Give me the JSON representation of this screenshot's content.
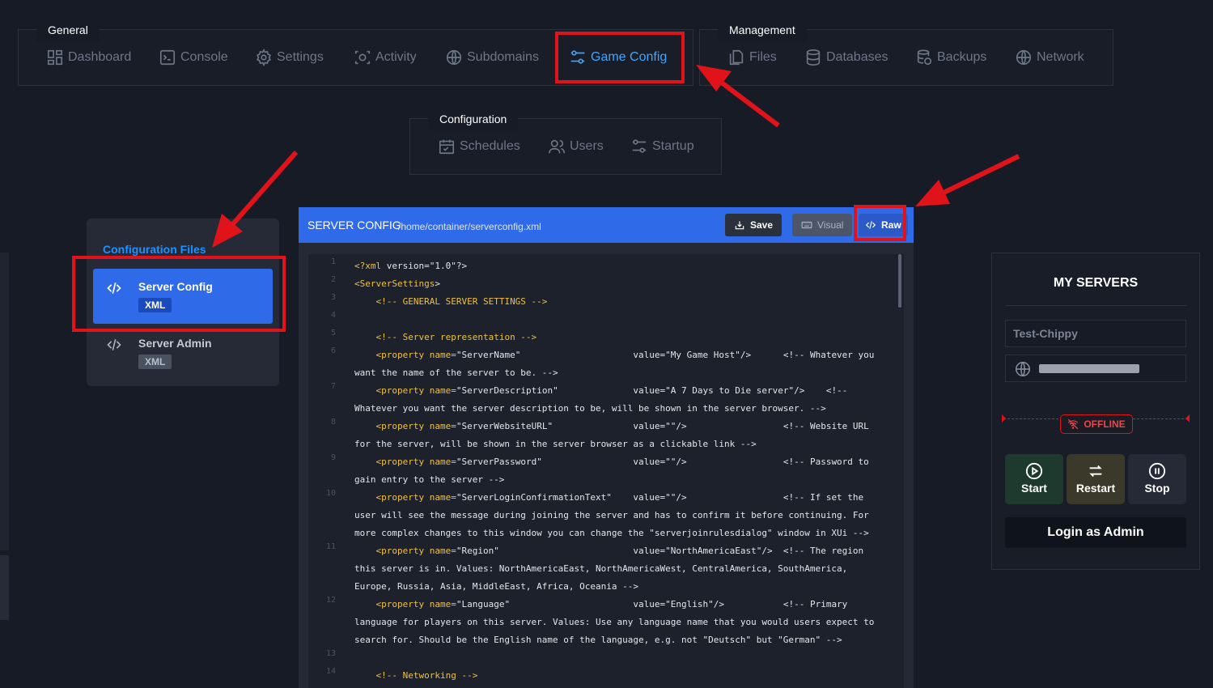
{
  "colors": {
    "background": "#161b25",
    "accent_blue": "#2f6ae8",
    "active_nav": "#3ea6ff",
    "annotation_red": "#e0131b",
    "code_tag": "#f0c040"
  },
  "nav_groups": {
    "general": {
      "title": "General",
      "items": [
        {
          "label": "Dashboard",
          "icon": "dashboard-icon"
        },
        {
          "label": "Console",
          "icon": "console-icon"
        },
        {
          "label": "Settings",
          "icon": "gear-icon"
        },
        {
          "label": "Activity",
          "icon": "activity-icon"
        },
        {
          "label": "Subdomains",
          "icon": "globe-icon"
        },
        {
          "label": "Game Config",
          "icon": "sliders-icon",
          "active": true
        }
      ]
    },
    "management": {
      "title": "Management",
      "items": [
        {
          "label": "Files",
          "icon": "files-icon"
        },
        {
          "label": "Databases",
          "icon": "database-icon"
        },
        {
          "label": "Backups",
          "icon": "backups-icon"
        },
        {
          "label": "Network",
          "icon": "globe-icon"
        }
      ]
    },
    "configuration": {
      "title": "Configuration",
      "items": [
        {
          "label": "Schedules",
          "icon": "calendar-icon"
        },
        {
          "label": "Users",
          "icon": "users-icon"
        },
        {
          "label": "Startup",
          "icon": "sliders-icon"
        }
      ]
    }
  },
  "config_files": {
    "title": "Configuration Files",
    "items": [
      {
        "name": "Server Config",
        "badge": "XML",
        "active": true
      },
      {
        "name": "Server Admin",
        "badge": "XML",
        "active": false
      }
    ]
  },
  "editor": {
    "title": "SERVER CONFIG",
    "path": "/home/container/serverconfig.xml",
    "save_label": "Save",
    "visual_label": "Visual",
    "raw_label": "Raw",
    "lines": [
      {
        "n": "1",
        "rows": [
          "<?xml version=\"1.0\"?>"
        ]
      },
      {
        "n": "2",
        "rows": [
          "<ServerSettings>"
        ]
      },
      {
        "n": "3",
        "rows": [
          "    <!-- GENERAL SERVER SETTINGS -->"
        ]
      },
      {
        "n": "4",
        "rows": [
          ""
        ]
      },
      {
        "n": "5",
        "rows": [
          "    <!-- Server representation -->"
        ]
      },
      {
        "n": "6",
        "rows": [
          "    <property name=\"ServerName\"                     value=\"My Game Host\"/>      <!-- Whatever you",
          "want the name of the server to be. -->"
        ]
      },
      {
        "n": "7",
        "rows": [
          "    <property name=\"ServerDescription\"              value=\"A 7 Days to Die server\"/>    <!--",
          "Whatever you want the server description to be, will be shown in the server browser. -->"
        ]
      },
      {
        "n": "8",
        "rows": [
          "    <property name=\"ServerWebsiteURL\"               value=\"\"/>                  <!-- Website URL",
          "for the server, will be shown in the server browser as a clickable link -->"
        ]
      },
      {
        "n": "9",
        "rows": [
          "    <property name=\"ServerPassword\"                 value=\"\"/>                  <!-- Password to",
          "gain entry to the server -->"
        ]
      },
      {
        "n": "10",
        "rows": [
          "    <property name=\"ServerLoginConfirmationText\"    value=\"\"/>                  <!-- If set the",
          "user will see the message during joining the server and has to confirm it before continuing. For",
          "more complex changes to this window you can change the \"serverjoinrulesdialog\" window in XUi -->"
        ]
      },
      {
        "n": "11",
        "rows": [
          "    <property name=\"Region\"                         value=\"NorthAmericaEast\"/>  <!-- The region",
          "this server is in. Values: NorthAmericaEast, NorthAmericaWest, CentralAmerica, SouthAmerica,",
          "Europe, Russia, Asia, MiddleEast, Africa, Oceania -->"
        ]
      },
      {
        "n": "12",
        "rows": [
          "    <property name=\"Language\"                       value=\"English\"/>           <!-- Primary",
          "language for players on this server. Values: Use any language name that you would users expect to",
          "search for. Should be the English name of the language, e.g. not \"Deutsch\" but \"German\" -->"
        ]
      },
      {
        "n": "13",
        "rows": [
          ""
        ]
      },
      {
        "n": "14",
        "rows": [
          "    <!-- Networking -->"
        ]
      }
    ]
  },
  "servers": {
    "title": "MY SERVERS",
    "server_name": "Test-Chippy",
    "status": "OFFLINE",
    "start_label": "Start",
    "restart_label": "Restart",
    "stop_label": "Stop",
    "login_label": "Login as Admin"
  }
}
